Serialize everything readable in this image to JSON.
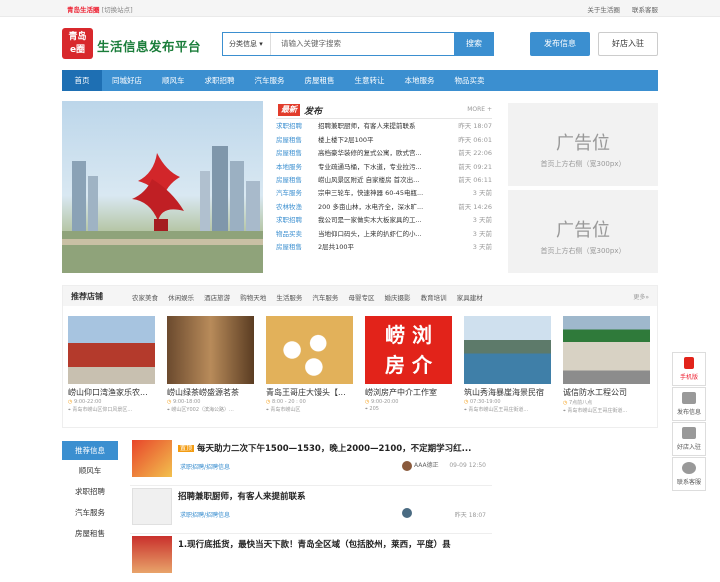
{
  "topbar": {
    "city": "青岛生活圈",
    "switch": "[切换站点]",
    "links": [
      "关于生活圈",
      "联系客服"
    ]
  },
  "logo": {
    "mark": "青岛 生活圈",
    "name": "生活信息发布平台"
  },
  "search": {
    "category": "分类信息",
    "placeholder": "请输入关键字搜索",
    "button": "搜索"
  },
  "header": {
    "publish": "发布信息",
    "join": "好店入驻"
  },
  "nav": [
    "首页",
    "同城好店",
    "顺风车",
    "求职招聘",
    "汽车服务",
    "房屋租售",
    "生意转让",
    "本地服务",
    "物品买卖"
  ],
  "latest": {
    "tag": "最新",
    "title": "发布",
    "more": "MORE +",
    "rows": [
      {
        "cat": "求职招聘",
        "title": "招聘兼职厨师，有客人来提前联系",
        "time": "昨天 18:07"
      },
      {
        "cat": "房屋租售",
        "title": "楼上楼下2层100平",
        "time": "昨天 06:01"
      },
      {
        "cat": "房屋租售",
        "title": "高档豪华装修的复式公寓，欧式宫...",
        "time": "前天 22:06"
      },
      {
        "cat": "本地服务",
        "title": "专业疏通马桶，下水道，专业拉污...",
        "time": "前天 09:21"
      },
      {
        "cat": "房屋租售",
        "title": "崂山风景区附近 自家楼房 首次出...",
        "time": "前天 06:11"
      },
      {
        "cat": "汽车服务",
        "title": "宗申三轮车，快速神器 60-45电瓶...",
        "time": "3 天前"
      },
      {
        "cat": "农林牧渔",
        "title": "200 多亩山林，水电齐全，深水旷...",
        "time": "前天 14:26"
      },
      {
        "cat": "求职招聘",
        "title": "我公司是一家做实木大板家具的工...",
        "time": "3 天前"
      },
      {
        "cat": "物品买卖",
        "title": "当地仰口码头，上来的扒虾仁的小...",
        "time": "3 天前"
      },
      {
        "cat": "房屋租售",
        "title": "2层共100平",
        "time": "3 天前"
      }
    ]
  },
  "ads": [
    {
      "title": "广告位",
      "sub": "首页上方右侧（宽300px）"
    },
    {
      "title": "广告位",
      "sub": "首页上方右侧（宽300px）"
    }
  ],
  "shops": {
    "title": "推荐店铺",
    "more": "更多»",
    "cats": [
      "农家美食",
      "休闲娱乐",
      "酒店旅游",
      "购物天地",
      "生活服务",
      "汽车服务",
      "母婴专区",
      "婚庆摄影",
      "教育培训",
      "家具建材"
    ],
    "items": [
      {
        "name": "崂山仰口湾渔家乐农...",
        "hours": "9:00-22:00",
        "addr": "青岛市崂山区仰口风景区..."
      },
      {
        "name": "崂山绿茶崂盛源茗茶",
        "hours": "9:00-18:00",
        "addr": "崂山区Y002（滨海公路）..."
      },
      {
        "name": "青岛王哥庄大馒头【...",
        "hours": "8:00 - 20 : 00",
        "addr": "青岛市崂山区"
      },
      {
        "name": "崂浏房产中介工作室",
        "hours": "9:00-20:00",
        "addr": "205"
      },
      {
        "name": "筑山秀海暴崖海景民宿",
        "hours": "07:30-19:00",
        "addr": "青岛市崂山区王哥庄街道..."
      },
      {
        "name": "诚信防水工程公司",
        "hours": "7点前八点",
        "addr": "青岛市崂山区王哥庄街道..."
      }
    ]
  },
  "sidebar": {
    "head": "推荐信息",
    "items": [
      "顺风车",
      "求职招聘",
      "汽车服务",
      "房屋租售"
    ]
  },
  "feed": [
    {
      "tag": "置顶",
      "title": "每天助力二次下午1500—1530，晚上2000—2100，不定期学习红...",
      "cat": "求职招聘/招聘信息",
      "user": "AAA德正",
      "time": "09-09 12:50"
    },
    {
      "tag": "",
      "title": "招聘兼职厨师，有客人来提前联系",
      "cat": "求职招聘/招聘信息",
      "user": "",
      "time": "昨天 18:07"
    },
    {
      "tag": "",
      "title": "1.现行底抵货，最快当天下款！青岛全区域（包括胶州，莱西，平度）县",
      "cat": "",
      "user": "",
      "time": ""
    }
  ],
  "float": [
    "手机版",
    "发布信息",
    "好店入驻",
    "联系客服"
  ]
}
